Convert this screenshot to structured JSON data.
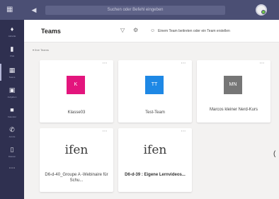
{
  "topbar": {
    "search_placeholder": "Suchen oder Befehl eingeben",
    "icons": {
      "apps": "grid-icon",
      "back": "back-icon"
    }
  },
  "rail": {
    "items": [
      {
        "label": "Aktivität",
        "icon": "bell-icon"
      },
      {
        "label": "Chat",
        "icon": "chat-icon"
      },
      {
        "label": "Teams",
        "icon": "teams-icon",
        "active": true
      },
      {
        "label": "Aufgaben",
        "icon": "clipboard-icon"
      },
      {
        "label": "Kalender",
        "icon": "calendar-icon"
      },
      {
        "label": "Anrufe",
        "icon": "phone-icon"
      },
      {
        "label": "Dateien",
        "icon": "file-icon"
      },
      {
        "label": "",
        "icon": "more-icon"
      }
    ]
  },
  "header": {
    "title": "Teams",
    "join_label": "Einem Team beitreten oder ein Team erstellen"
  },
  "section": {
    "label": "Ihre Teams"
  },
  "teams": [
    {
      "name": "Klasse03",
      "initials": "K",
      "tile_color": "#e3157d",
      "kind": "tile"
    },
    {
      "name": "Test-Team",
      "initials": "TT",
      "tile_color": "#1e88e5",
      "kind": "tile"
    },
    {
      "name": "Marcos kleiner Nerd-Kurs",
      "initials": "MN",
      "tile_color": "#767676",
      "kind": "tile"
    },
    {
      "name": "D6-d-40_Groupe A -Webinaire für Schu...",
      "logo": "ifen",
      "kind": "logo"
    },
    {
      "name": "D6-d-39 : Eigene Lernvideos...",
      "logo": "ifen",
      "kind": "logo",
      "bold": true
    }
  ],
  "colors": {
    "topbar": "#4b4f74",
    "rail": "#2f3050",
    "background": "#f3f2f1"
  }
}
